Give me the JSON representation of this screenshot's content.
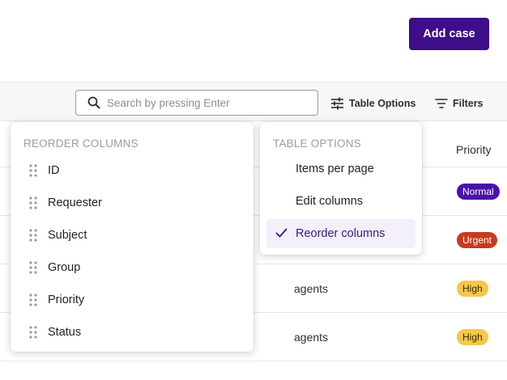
{
  "header": {
    "add_case_label": "Add case"
  },
  "toolbar": {
    "search_placeholder": "Search by pressing Enter",
    "table_options_label": "Table Options",
    "filters_label": "Filters"
  },
  "table": {
    "priority_header": "Priority",
    "rows": [
      {
        "group": "",
        "priority": "Normal"
      },
      {
        "group": "",
        "priority": "Urgent"
      },
      {
        "group": "agents",
        "priority": "High"
      },
      {
        "group": "agents",
        "priority": "High"
      }
    ]
  },
  "reorder_menu": {
    "title": "REORDER COLUMNS",
    "items": [
      "ID",
      "Requester",
      "Subject",
      "Group",
      "Priority",
      "Status"
    ]
  },
  "options_menu": {
    "title": "TABLE OPTIONS",
    "items": [
      "Items per page",
      "Edit columns",
      "Reorder columns"
    ],
    "selected": "Reorder columns"
  },
  "colors": {
    "primary": "#3d0d8a",
    "normal_badge": "#4a12a8",
    "urgent_badge": "#c73a1f",
    "high_badge": "#f5c84a"
  }
}
